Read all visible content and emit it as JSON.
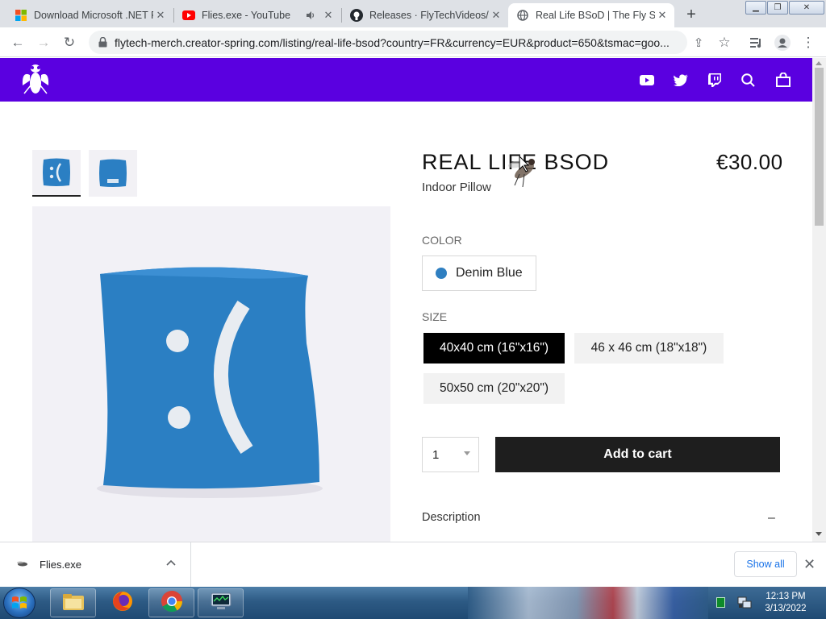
{
  "browser": {
    "tabs": [
      {
        "label": "Download Microsoft .NET F",
        "favicon": "windows-icon",
        "active": false
      },
      {
        "label": "Flies.exe - YouTube",
        "favicon": "youtube-icon",
        "active": false,
        "audio": true
      },
      {
        "label": "Releases · FlyTechVideos/F",
        "favicon": "github-icon",
        "active": false
      },
      {
        "label": "Real Life BSoD | The Fly Sto",
        "favicon": "globe-icon",
        "active": true
      }
    ],
    "url": "flytech-merch.creator-spring.com/listing/real-life-bsod?country=FR&currency=EUR&product=650&tsmac=goo..."
  },
  "site": {
    "brand_color": "#5a00e0",
    "header_icons": [
      "youtube-icon",
      "twitter-icon",
      "twitch-icon",
      "search-icon",
      "bag-icon"
    ]
  },
  "product": {
    "title": "REAL LIFE BSOD",
    "subtitle": "Indoor Pillow",
    "price": "€30.00",
    "color_label": "COLOR",
    "color_value": "Denim Blue",
    "color_hex": "#2f7fc1",
    "size_label": "SIZE",
    "sizes": [
      {
        "label": "40x40 cm (16\"x16\")",
        "selected": true
      },
      {
        "label": "46 x 46 cm (18\"x18\")",
        "selected": false
      },
      {
        "label": "50x50 cm (20\"x20\")",
        "selected": false
      }
    ],
    "quantity": "1",
    "add_to_cart": "Add to cart",
    "description_label": "Description",
    "description_toggle": "–"
  },
  "downloads": {
    "file_name": "Flies.exe",
    "show_all": "Show all"
  },
  "taskbar": {
    "time": "12:13 PM",
    "date": "3/13/2022"
  }
}
